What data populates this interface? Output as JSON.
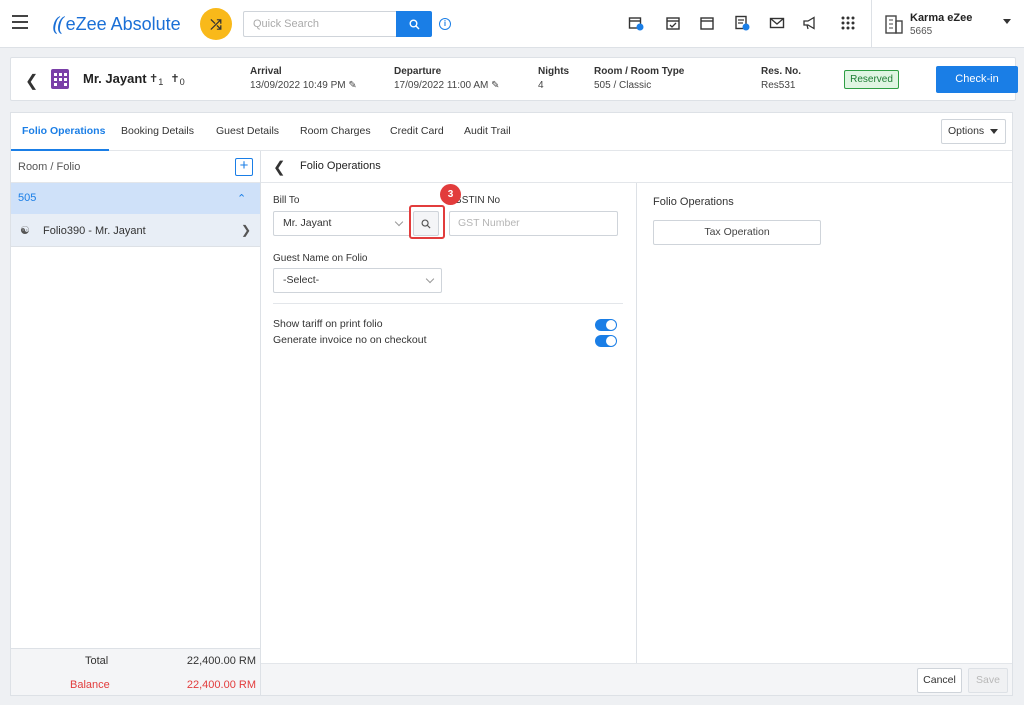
{
  "app": {
    "brand": "eZee Absolute",
    "accent": "#1a7ee6"
  },
  "search": {
    "placeholder": "Quick Search"
  },
  "toolbar_icons": [
    "calendar-plus-icon",
    "calendar-check-icon",
    "calendar-icon",
    "invoice-icon",
    "mail-icon",
    "megaphone-icon",
    "apps-grid-icon"
  ],
  "account": {
    "name": "Karma eZee",
    "code": "5665"
  },
  "reservation": {
    "guest": "Mr. Jayant",
    "adults": "1",
    "children": "0",
    "arrival_label": "Arrival",
    "arrival": "13/09/2022 10:49 PM",
    "departure_label": "Departure",
    "departure": "17/09/2022 11:00 AM",
    "nights_label": "Nights",
    "nights": "4",
    "room_label": "Room / Room Type",
    "room": "505 / Classic",
    "resno_label": "Res. No.",
    "resno": "Res531",
    "status": "Reserved",
    "checkin": "Check-in"
  },
  "tabs": [
    "Folio Operations",
    "Booking Details",
    "Guest Details",
    "Room Charges",
    "Credit Card",
    "Audit Trail"
  ],
  "options": "Options",
  "sidebar": {
    "header": "Room / Folio",
    "room": "505",
    "folio": "Folio390 - Mr. Jayant",
    "total_label": "Total",
    "total": "22,400.00 RM",
    "balance_label": "Balance",
    "balance": "22,400.00 RM"
  },
  "form": {
    "title": "Folio Operations",
    "bill_to_label": "Bill To",
    "bill_to": "Mr. Jayant",
    "gstin_label": "GSTIN No",
    "gstin_placeholder": "GST Number",
    "guest_name_label": "Guest Name on Folio",
    "guest_name": "-Select-",
    "step": "3",
    "toggle1": "Show tariff on print folio",
    "toggle2": "Generate invoice no on checkout"
  },
  "ops": {
    "title": "Folio Operations",
    "tax_button": "Tax Operation"
  },
  "footer": {
    "cancel": "Cancel",
    "save": "Save"
  }
}
